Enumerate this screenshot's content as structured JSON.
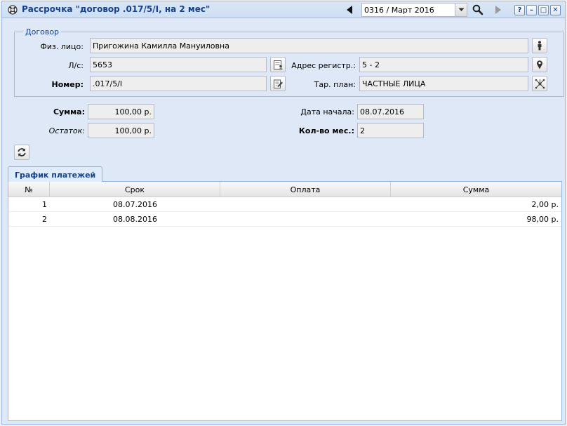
{
  "window": {
    "title": "Рассрочка \"договор .017/5/I, на 2 мес\"",
    "period": "0316 / Март 2016",
    "help_label": "?",
    "minimize_label": "–",
    "maximize_label": "□",
    "close_label": "✕"
  },
  "contract": {
    "legend": "Договор",
    "person_label": "Физ. лицо:",
    "person_value": "Пригожина Камилла Мануиловна",
    "account_label": "Л/с:",
    "account_value": "5653",
    "address_label": "Адрес регистр.:",
    "address_value": "5 - 2",
    "number_label": "Номер:",
    "number_value": ".017/5/I",
    "tariff_label": "Тар. план:",
    "tariff_value": "ЧАСТНЫЕ ЛИЦА"
  },
  "summary": {
    "sum_label": "Сумма:",
    "sum_value": "100,00 р.",
    "rest_label": "Остаток:",
    "rest_value": "100,00 р.",
    "start_label": "Дата начала:",
    "start_value": "08.07.2016",
    "months_label": "Кол-во мес.:",
    "months_value": "2"
  },
  "tabs": [
    "График платежей"
  ],
  "grid": {
    "columns": [
      "№",
      "Срок",
      "Оплата",
      "Сумма"
    ],
    "rows": [
      {
        "num": "1",
        "term": "08.07.2016",
        "payment": "",
        "amount": "2,00 р."
      },
      {
        "num": "2",
        "term": "08.08.2016",
        "payment": "",
        "amount": "98,00 р."
      }
    ]
  },
  "colors": {
    "window_bg": "#dfe8f6",
    "border": "#99bbe8",
    "title_text": "#15428b"
  }
}
